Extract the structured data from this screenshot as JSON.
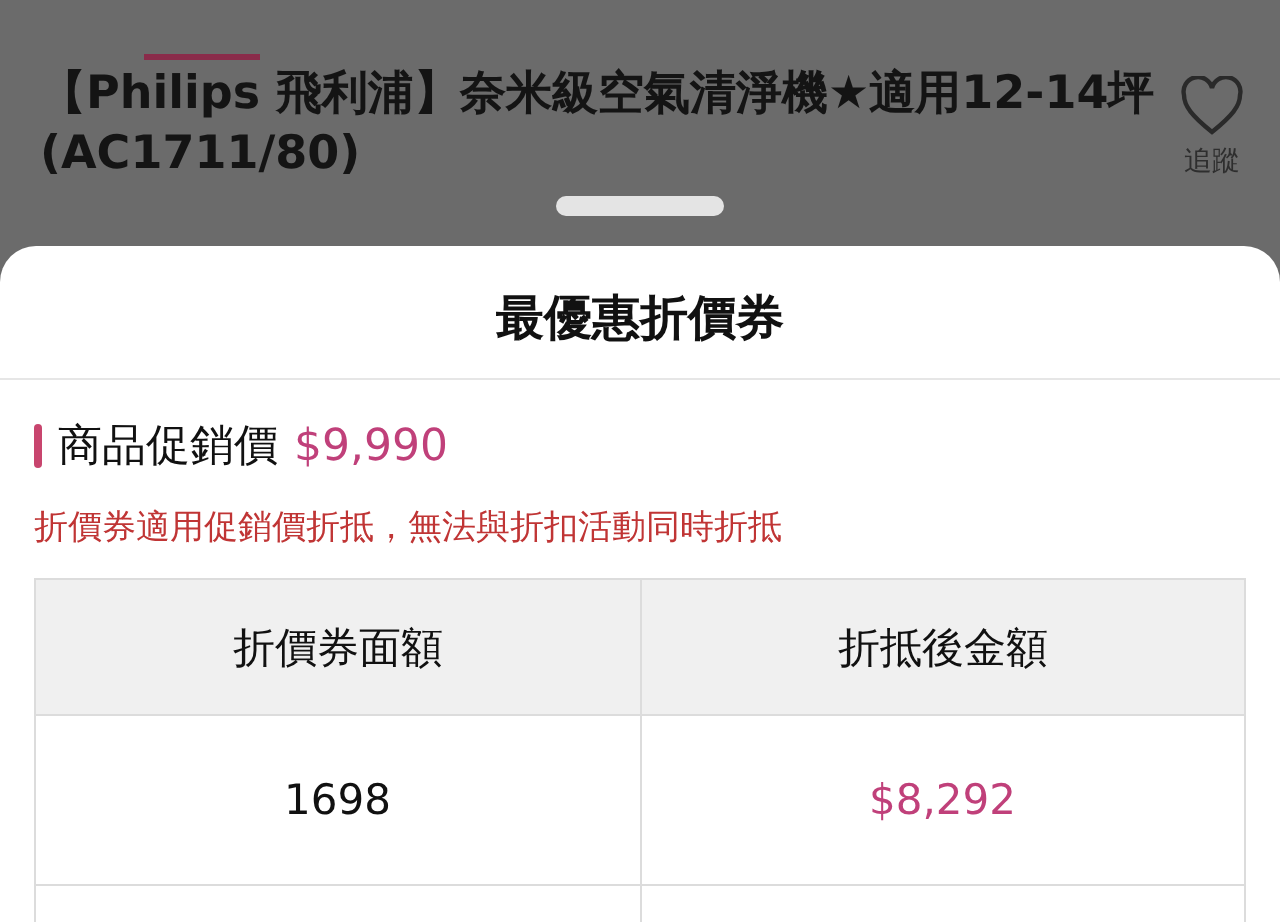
{
  "product": {
    "title": "【Philips 飛利浦】奈米級空氣清淨機★適用12-14坪 (AC1711/80)",
    "follow_label": "追蹤"
  },
  "sheet": {
    "title": "最優惠折價券",
    "price_label": "商品促銷價",
    "price": "$9,990",
    "note": "折價券適用促銷價折抵，無法與折扣活動同時折抵",
    "table": {
      "columns": [
        "折價券面額",
        "折抵後金額"
      ],
      "rows": [
        [
          "1698",
          "$8,292"
        ]
      ]
    }
  }
}
